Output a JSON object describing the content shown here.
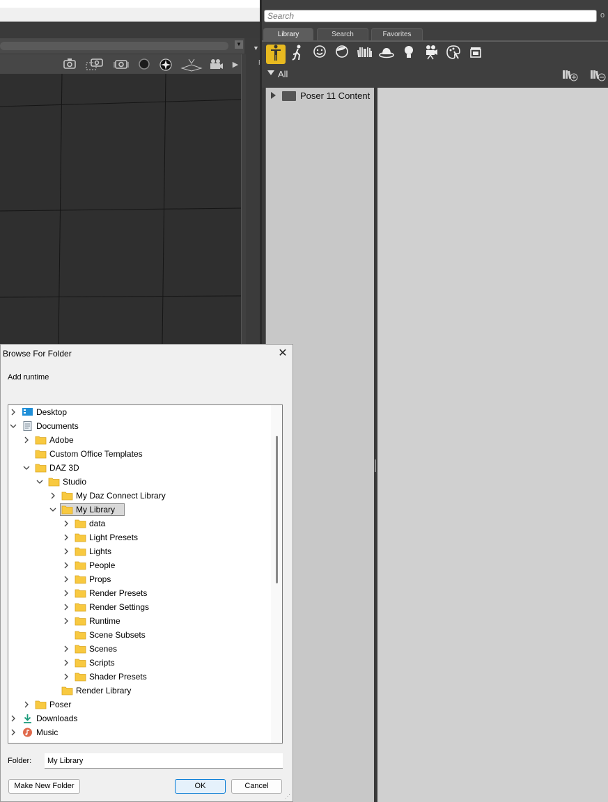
{
  "viewport": {
    "menu_arrow": "▼",
    "side_label": "F",
    "toolbar_icons": [
      "camera-icon",
      "camera-dashed-icon",
      "camera-rotate-icon",
      "sphere-icon",
      "light-sphere-icon",
      "plane-icon",
      "movie-camera-icon"
    ]
  },
  "content_library": {
    "search_placeholder": "Search",
    "search_side": "o",
    "tabs": [
      {
        "label": "Library",
        "active": true
      },
      {
        "label": "Search",
        "active": false
      },
      {
        "label": "Favorites",
        "active": false
      }
    ],
    "categories": [
      "figure-icon",
      "pose-icon",
      "face-icon",
      "hair-icon",
      "hands-icon",
      "props-icon",
      "light-icon",
      "camera-icon",
      "materials-icon",
      "scenes-icon"
    ],
    "filter_label": "All",
    "tree": [
      {
        "label": "Poser 11 Content",
        "expanded": false
      }
    ]
  },
  "dialog": {
    "title": "Browse For Folder",
    "close": "✕",
    "description": "Add runtime",
    "tree": [
      {
        "label": "Desktop",
        "level": 0,
        "chevron": "right",
        "icon": "desktop"
      },
      {
        "label": "Documents",
        "level": 0,
        "chevron": "down",
        "icon": "documents"
      },
      {
        "label": "Adobe",
        "level": 1,
        "chevron": "right",
        "icon": "folder"
      },
      {
        "label": "Custom Office Templates",
        "level": 1,
        "chevron": "none",
        "icon": "folder"
      },
      {
        "label": "DAZ 3D",
        "level": 1,
        "chevron": "down",
        "icon": "folder"
      },
      {
        "label": "Studio",
        "level": 2,
        "chevron": "down",
        "icon": "folder"
      },
      {
        "label": "My Daz Connect Library",
        "level": 3,
        "chevron": "right",
        "icon": "folder"
      },
      {
        "label": "My Library",
        "level": 3,
        "chevron": "down",
        "icon": "folder",
        "selected": true
      },
      {
        "label": "data",
        "level": 4,
        "chevron": "right",
        "icon": "folder"
      },
      {
        "label": "Light Presets",
        "level": 4,
        "chevron": "right",
        "icon": "folder"
      },
      {
        "label": "Lights",
        "level": 4,
        "chevron": "right",
        "icon": "folder"
      },
      {
        "label": "People",
        "level": 4,
        "chevron": "right",
        "icon": "folder"
      },
      {
        "label": "Props",
        "level": 4,
        "chevron": "right",
        "icon": "folder"
      },
      {
        "label": "Render Presets",
        "level": 4,
        "chevron": "right",
        "icon": "folder"
      },
      {
        "label": "Render Settings",
        "level": 4,
        "chevron": "right",
        "icon": "folder"
      },
      {
        "label": "Runtime",
        "level": 4,
        "chevron": "right",
        "icon": "folder"
      },
      {
        "label": "Scene Subsets",
        "level": 4,
        "chevron": "none",
        "icon": "folder"
      },
      {
        "label": "Scenes",
        "level": 4,
        "chevron": "right",
        "icon": "folder"
      },
      {
        "label": "Scripts",
        "level": 4,
        "chevron": "right",
        "icon": "folder"
      },
      {
        "label": "Shader Presets",
        "level": 4,
        "chevron": "right",
        "icon": "folder"
      },
      {
        "label": "Render Library",
        "level": 3,
        "chevron": "none",
        "icon": "folder"
      },
      {
        "label": "Poser",
        "level": 1,
        "chevron": "right",
        "icon": "folder"
      },
      {
        "label": "Downloads",
        "level": 0,
        "chevron": "right",
        "icon": "downloads"
      },
      {
        "label": "Music",
        "level": 0,
        "chevron": "right",
        "icon": "music"
      }
    ],
    "folder_label": "Folder:",
    "folder_value": "My Library",
    "make_new_folder": "Make New Folder",
    "ok": "OK",
    "cancel": "Cancel"
  },
  "colors": {
    "accent_yellow": "#e7b920",
    "folder_yellow": "#f8c940",
    "ok_border": "#0078d4"
  }
}
